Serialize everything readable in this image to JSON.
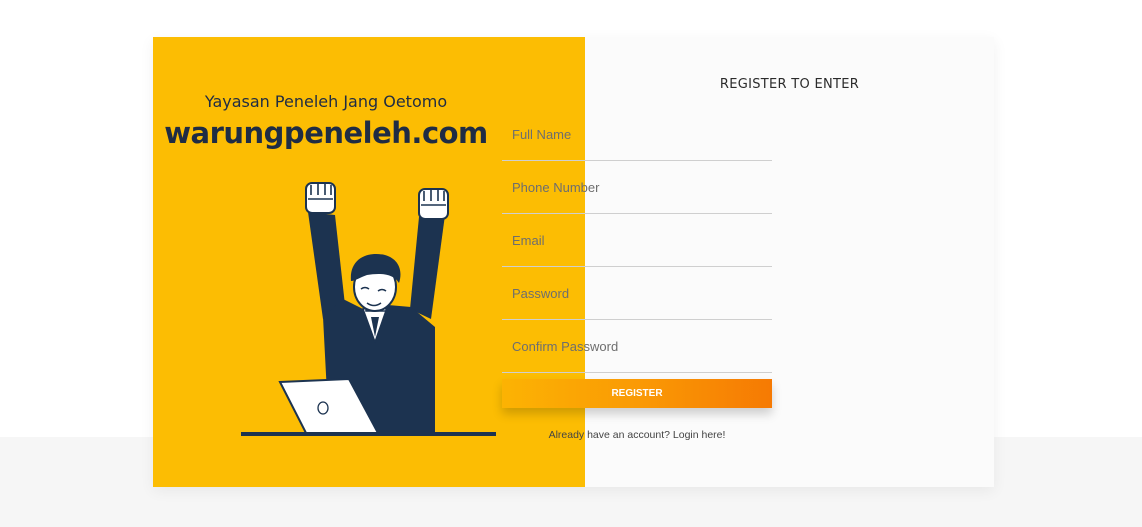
{
  "brand": {
    "organization": "Yayasan Peneleh Jang Oetomo",
    "site": "warungpeneleh.com",
    "accent_color": "#fcbd03",
    "text_color": "#1f2c44"
  },
  "illustration": {
    "icon": "celebrating-person-with-laptop-icon"
  },
  "form": {
    "title": "REGISTER TO ENTER",
    "fields": {
      "full_name": {
        "placeholder": "Full Name",
        "value": ""
      },
      "phone": {
        "placeholder": "Phone Number",
        "value": ""
      },
      "email": {
        "placeholder": "Email",
        "value": ""
      },
      "password": {
        "placeholder": "Password",
        "value": ""
      },
      "confirm_password": {
        "placeholder": "Confirm Password",
        "value": ""
      }
    },
    "submit_label": "REGISTER",
    "login_text": "Already have an account? Login here!"
  }
}
